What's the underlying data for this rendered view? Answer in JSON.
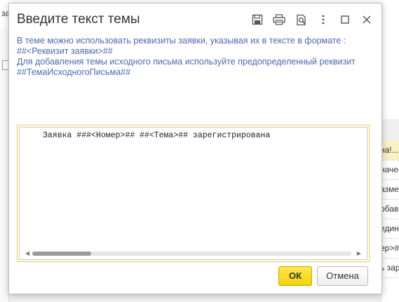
{
  "background": {
    "topbar_fragment": "за",
    "right_rows": [
      "на!...",
      "начен",
      "азме",
      "обав",
      "един",
      "ер>#",
      "ь зар"
    ]
  },
  "dialog": {
    "title": "Введите текст темы",
    "hint_lines": [
      "В теме можно использовать реквизиты заявки, указывая их в тексте в формате :",
      "##<Реквизит заявки>##",
      "Для добавления темы исходного письма используйте предопределенный реквизит",
      "##ТемаИсходногоПисьма##"
    ],
    "editor_value": "Заявка ###<Номер>## ##<Тема>## зарегистрирована",
    "ok_label": "ОК",
    "cancel_label": "Отмена"
  },
  "colors": {
    "accent": "#f5d20e",
    "hint_text": "#4b6ab0",
    "editor_focus_border": "#e6cf5a"
  },
  "icons": [
    "save-icon",
    "print-icon",
    "preview-icon",
    "more-icon",
    "maximize-icon",
    "close-icon"
  ]
}
